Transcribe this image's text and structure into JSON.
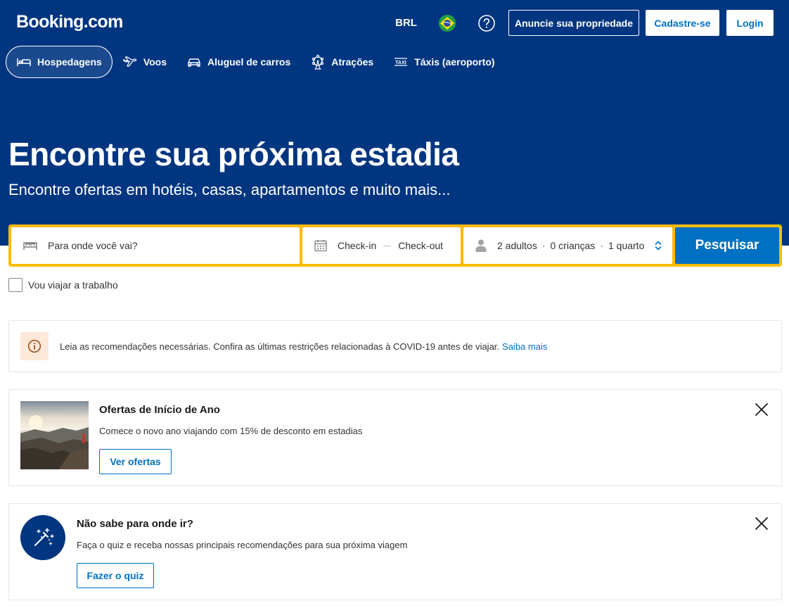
{
  "header": {
    "logo": "Booking.com",
    "currency": "BRL",
    "flag_icon": "brazil-flag-icon",
    "help_icon": "question-circle-icon",
    "list_property_label": "Anuncie sua propriedade",
    "signup_label": "Cadastre-se",
    "login_label": "Login"
  },
  "nav": {
    "items": [
      {
        "label": "Hospedagens",
        "icon": "bed-icon",
        "active": true
      },
      {
        "label": "Voos",
        "icon": "plane-icon",
        "active": false
      },
      {
        "label": "Aluguel de carros",
        "icon": "car-icon",
        "active": false
      },
      {
        "label": "Atrações",
        "icon": "ferris-wheel-icon",
        "active": false
      },
      {
        "label": "Táxis (aeroporto)",
        "icon": "taxi-icon",
        "active": false
      }
    ]
  },
  "hero": {
    "title": "Encontre sua próxima estadia",
    "subtitle": "Encontre ofertas em hotéis, casas, apartamentos e muito mais..."
  },
  "search": {
    "destination_placeholder": "Para onde você vai?",
    "checkin": "Check-in",
    "checkout": "Check-out",
    "adults": "2 adultos",
    "children": "0 crianças",
    "rooms": "1 quarto",
    "separator": "·",
    "button_label": "Pesquisar"
  },
  "work_travel": {
    "label": "Vou viajar a trabalho"
  },
  "covid_notice": {
    "text": "Leia as recomendações necessárias. Confira as últimas restrições relacionadas à COVID-19 antes de viajar.",
    "link": "Saiba mais"
  },
  "promo": {
    "title": "Ofertas de Início de Ano",
    "text": "Comece o novo ano viajando com 15% de desconto em estadias",
    "button": "Ver ofertas"
  },
  "quiz": {
    "title": "Não sabe para onde ir?",
    "text": "Faça o quiz e receba nossas principais recomendações para sua próxima viagem",
    "button": "Fazer o quiz"
  },
  "colors": {
    "brand_blue": "#003580",
    "action_blue": "#0071c2",
    "search_border": "#febb02"
  }
}
